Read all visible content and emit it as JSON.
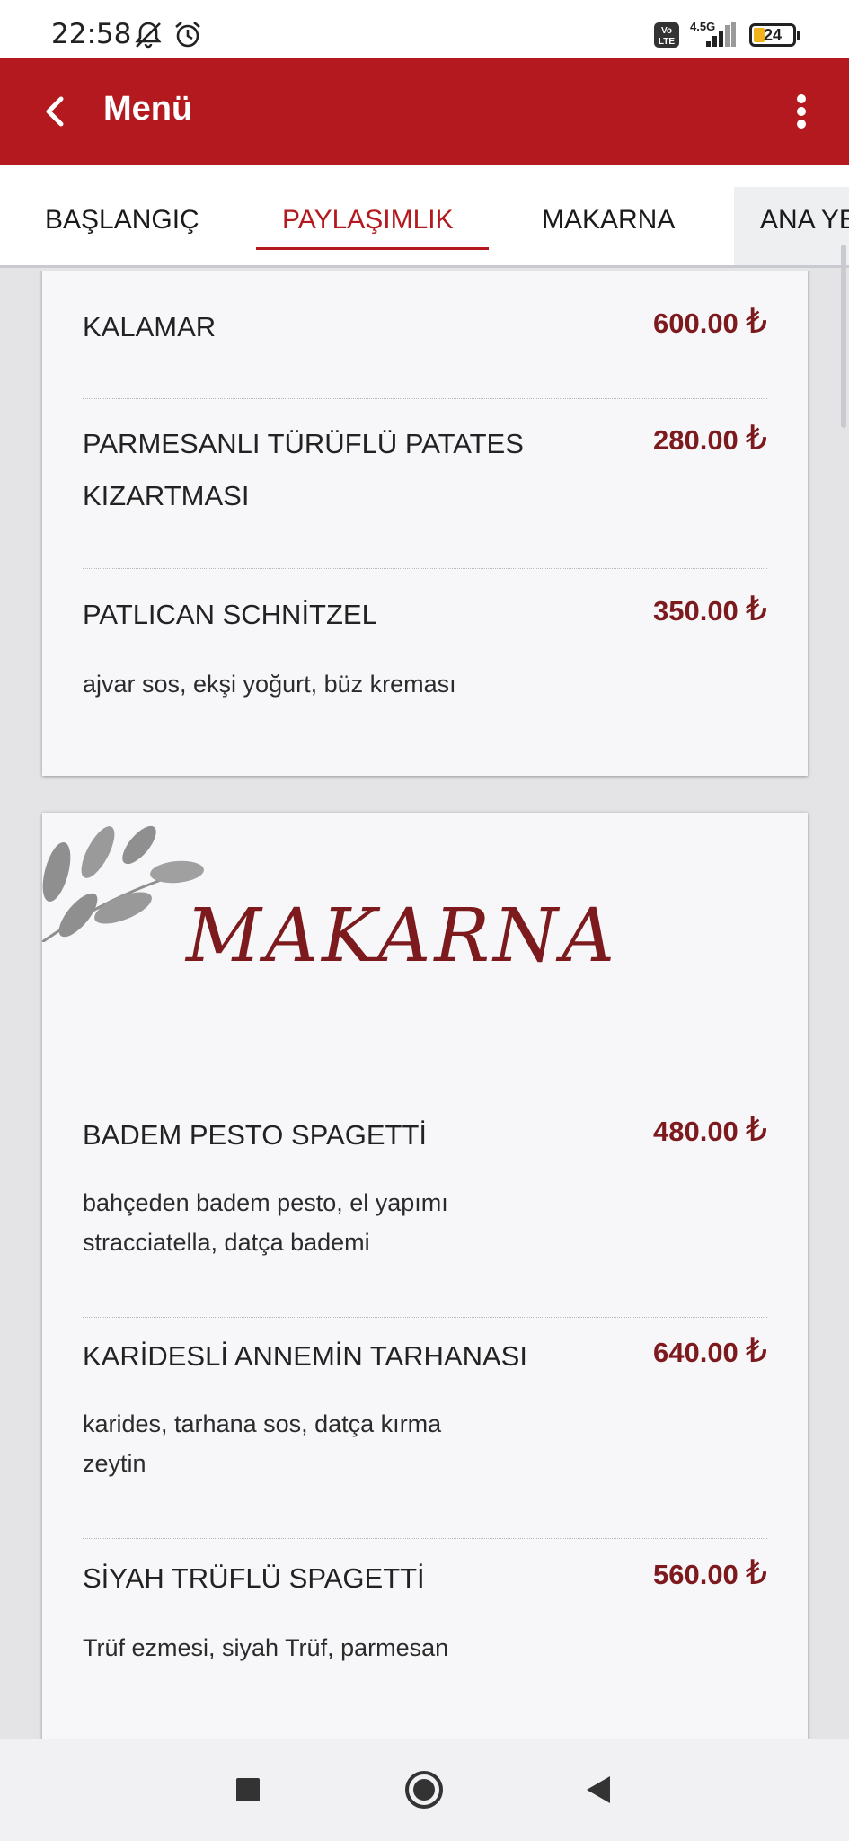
{
  "status_bar": {
    "time": "22:58",
    "battery": "24",
    "network": "4.5G",
    "icons": [
      "mute-icon",
      "alarm-icon",
      "volte-icon",
      "signal-icon",
      "battery-icon"
    ]
  },
  "app_bar": {
    "title": "Menü",
    "back_icon": "chevron-left-icon",
    "more_icon": "more-vertical-icon"
  },
  "tabs": [
    {
      "label": "BAŞLANGIÇ",
      "active": false
    },
    {
      "label": "PAYLAŞIMLIK",
      "active": true
    },
    {
      "label": "MAKARNA",
      "active": false
    },
    {
      "label": "ANA YEMEK",
      "active": false
    }
  ],
  "sections": [
    {
      "title": "",
      "items": [
        {
          "name": "KALAMAR",
          "price": "600.00",
          "description": ""
        },
        {
          "name": "PARMESANLI TÜRÜFLÜ PATATES KIZARTMASI",
          "price": "280.00",
          "description": ""
        },
        {
          "name": "PATLICAN SCHNİTZEL",
          "price": "350.00",
          "description": "ajvar sos, ekşi yoğurt, büz kreması"
        }
      ]
    },
    {
      "title": "MAKARNA",
      "items": [
        {
          "name": "BADEM PESTO SPAGETTİ",
          "price": "480.00",
          "description": "bahçeden badem pesto, el yapımı stracciatella, datça bademi"
        },
        {
          "name": "KARİDESLİ ANNEMİN TARHANASI",
          "price": "640.00",
          "description": "karides, tarhana sos, datça kırma zeytin"
        },
        {
          "name": "SİYAH TRÜFLÜ SPAGETTİ",
          "price": "560.00",
          "description": "Trüf ezmesi, siyah Trüf, parmesan"
        }
      ]
    }
  ],
  "currency_symbol": "₺",
  "colors": {
    "brand": "#b3191e",
    "price": "#7c1a1e"
  },
  "nav_bar": {
    "icons": [
      "recents-square-icon",
      "home-circle-icon",
      "back-triangle-icon"
    ]
  }
}
